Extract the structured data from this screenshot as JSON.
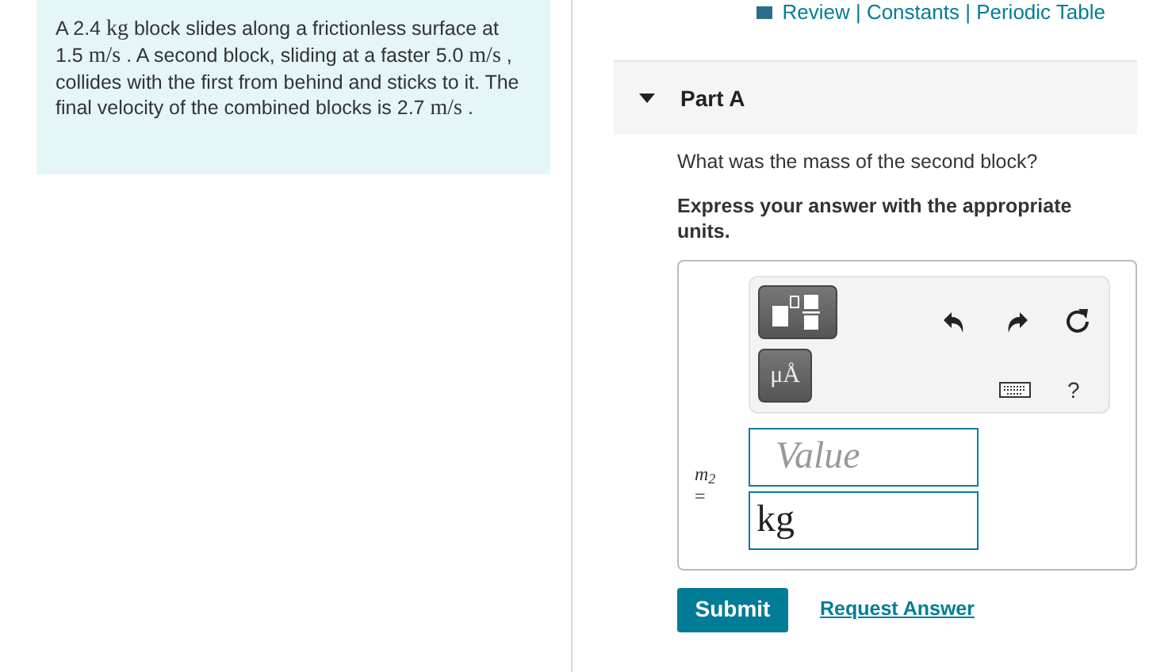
{
  "problem": {
    "segments": [
      {
        "kind": "text",
        "text": "A 2.4 "
      },
      {
        "kind": "math",
        "text": "kg"
      },
      {
        "kind": "text",
        "text": " block slides along a frictionless surface at 1.5 "
      },
      {
        "kind": "math",
        "text": "m/s"
      },
      {
        "kind": "text",
        "text": " . A second block, sliding at a faster 5.0 "
      },
      {
        "kind": "math",
        "text": "m/s"
      },
      {
        "kind": "text",
        "text": " , collides with the first from behind and sticks to it. The final velocity of the combined blocks is 2.7 "
      },
      {
        "kind": "math",
        "text": "m/s"
      },
      {
        "kind": "text",
        "text": " ."
      }
    ]
  },
  "top_links": "Review | Constants | Periodic Table",
  "part": {
    "title": "Part A",
    "expanded": true,
    "question": "What was the mass of the second block?",
    "instruction": "Express your answer with the appropriate units."
  },
  "toolbar": {
    "unit_button": "μÅ",
    "help": "?"
  },
  "answer": {
    "variable": "m$_{2}$",
    "equals": "=",
    "value_placeholder": "Value",
    "units_value": "kg"
  },
  "buttons": {
    "submit": "Submit",
    "request": "Request Answer"
  }
}
